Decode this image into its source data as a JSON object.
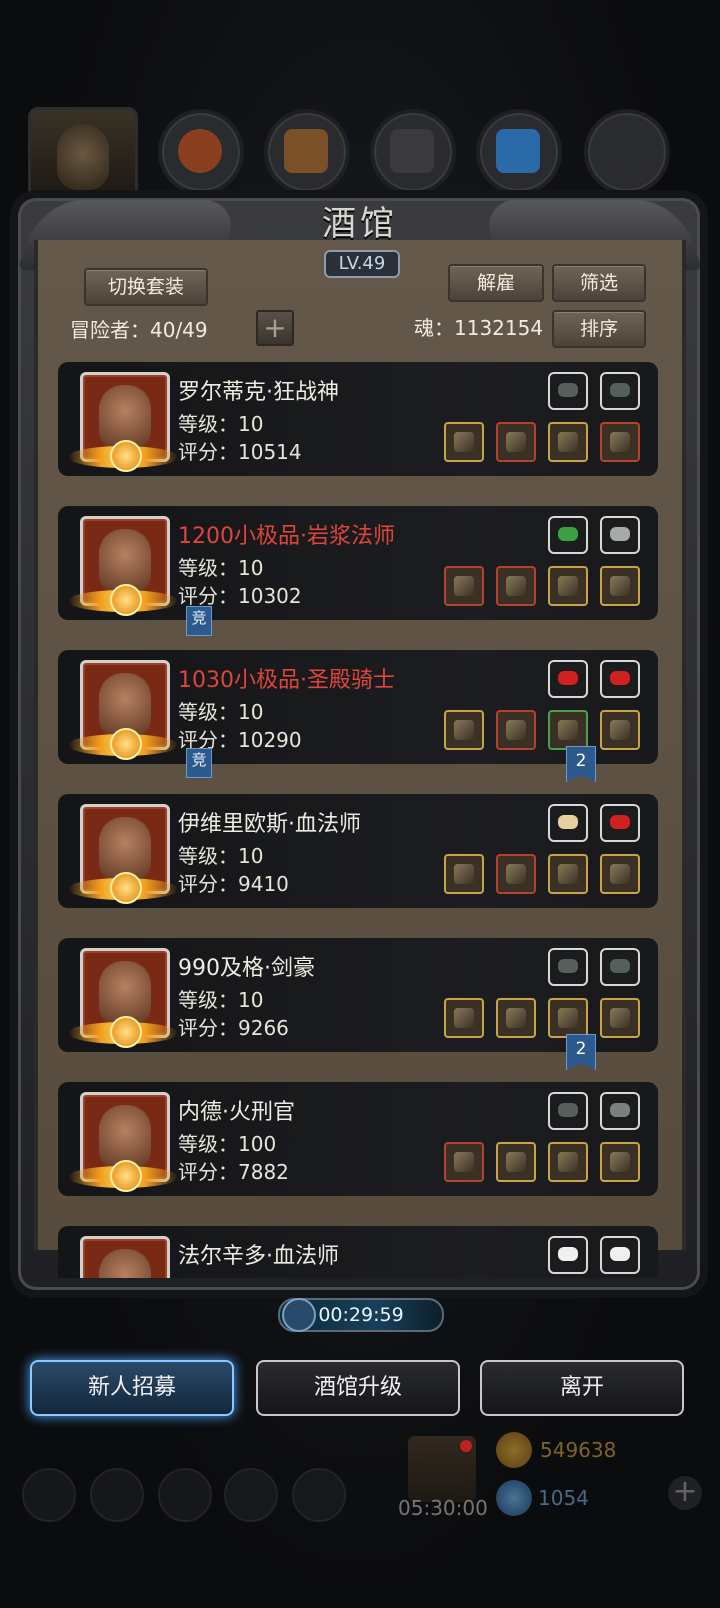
{
  "top": {
    "resource_values": [
      "",
      "",
      "",
      "",
      ""
    ]
  },
  "header": {
    "title": "酒馆",
    "level": "LV.49",
    "switch_outfit": "切换套装",
    "dismiss": "解雇",
    "filter": "筛选",
    "sort": "排序",
    "adventurers_label": "冒险者：40/49",
    "add": "+",
    "soul_label": "魂：1132154"
  },
  "heroes": [
    {
      "name": "罗尔蒂克·狂战神",
      "rare": false,
      "level": "等级：10",
      "score": "评分：10514",
      "gems": [
        "#55605c",
        "#55605c"
      ],
      "equip": [
        "#c8a448",
        "#b84030",
        "#c8a448",
        "#b84030"
      ]
    },
    {
      "name": "1200小极品·岩浆法师",
      "rare": true,
      "level": "等级：10",
      "score": "评分：10302",
      "gems": [
        "#3aa040",
        "#a8aaa8"
      ],
      "equip": [
        "#b84030",
        "#b84030",
        "#c8a448",
        "#c8a448"
      ]
    },
    {
      "name": "1030小极品·圣殿骑士",
      "rare": true,
      "level": "等级：10",
      "score": "评分：10290",
      "gems": [
        "#d02020",
        "#d02020"
      ],
      "equip": [
        "#c8a448",
        "#b84030",
        "#4aa048",
        "#c8a448"
      ]
    },
    {
      "name": "伊维里欧斯·血法师",
      "rare": false,
      "level": "等级：10",
      "score": "评分：9410",
      "gems": [
        "#e8d0a0",
        "#d02020"
      ],
      "equip": [
        "#c8a448",
        "#b84030",
        "#c8a448",
        "#c8a448"
      ]
    },
    {
      "name": "990及格·剑豪",
      "rare": false,
      "level": "等级：10",
      "score": "评分：9266",
      "gems": [
        "#55605c",
        "#55605c"
      ],
      "equip": [
        "#c8a448",
        "#c8a448",
        "#c8a448",
        "#c8a448"
      ]
    },
    {
      "name": "内德·火刑官",
      "rare": false,
      "level": "等级：100",
      "score": "评分：7882",
      "gems": [
        "#55605c",
        "#7a807c"
      ],
      "equip": [
        "#b84030",
        "#c8a448",
        "#c8a448",
        "#c8a448"
      ]
    },
    {
      "name": "法尔辛多·血法师",
      "rare": false,
      "level": "",
      "score": "",
      "gems": [
        "#f0f0f0",
        "#f0f0f0"
      ],
      "equip": []
    }
  ],
  "tags": {
    "competitive": "竞",
    "count_2": "2"
  },
  "timer": "00:29:59",
  "actions": {
    "recruit": "新人招募",
    "upgrade": "酒馆升级",
    "leave": "离开"
  },
  "bottom": {
    "gift_timer": "05:30:00",
    "gold": "549638",
    "gems": "1054",
    "add": "+"
  }
}
